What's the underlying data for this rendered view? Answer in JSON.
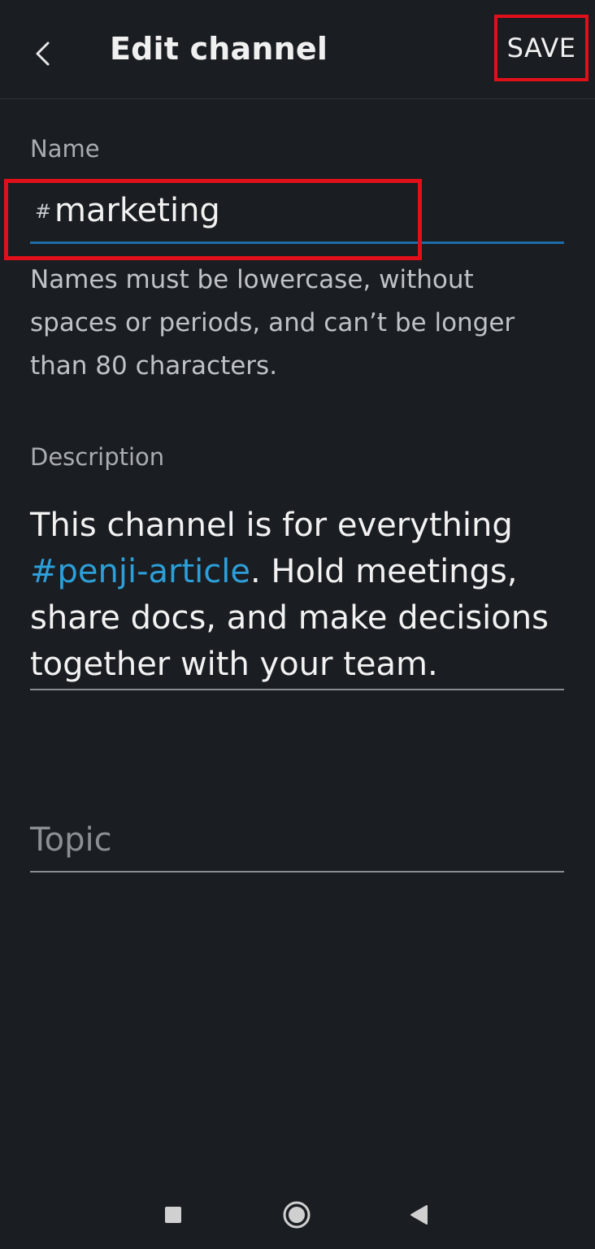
{
  "header": {
    "back_icon": "chevron-left-icon",
    "title": "Edit channel",
    "save_label": "SAVE"
  },
  "name_section": {
    "label": "Name",
    "prefix": "#",
    "value": "marketing",
    "hint": "Names must be lowercase, without spaces or periods, and can’t be longer than 80 characters."
  },
  "description_section": {
    "label": "Description",
    "text_before": "This channel is for everything ",
    "link_text": "#penji-article",
    "text_after": ". Hold meetings, share docs, and make decisions together with your team."
  },
  "topic_section": {
    "placeholder": "Topic"
  },
  "nav_bar": {
    "recents_icon": "square-icon",
    "home_icon": "circle-icon",
    "back_icon": "triangle-left-icon"
  },
  "colors": {
    "background": "#1a1d21",
    "accent_link": "#2d9fd8",
    "focus_underline": "#1e6ca8",
    "annotation_red": "#e0101a"
  }
}
